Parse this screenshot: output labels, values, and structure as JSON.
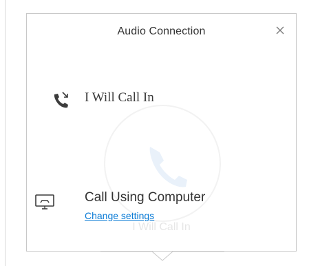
{
  "dialog": {
    "title": "Audio Connection",
    "close_glyph": "×"
  },
  "options": {
    "call_in": {
      "label": "I Will Call In",
      "icon": "phone-incoming-icon"
    },
    "computer": {
      "label": "Call Using Computer",
      "icon": "computer-audio-icon",
      "link": "Change settings"
    }
  },
  "background": {
    "watermark_label": "I Will Call In"
  },
  "colors": {
    "link": "#0a7bd6",
    "text": "#333333",
    "border": "#c8c8c8",
    "watermark": "#e6e6e6"
  }
}
